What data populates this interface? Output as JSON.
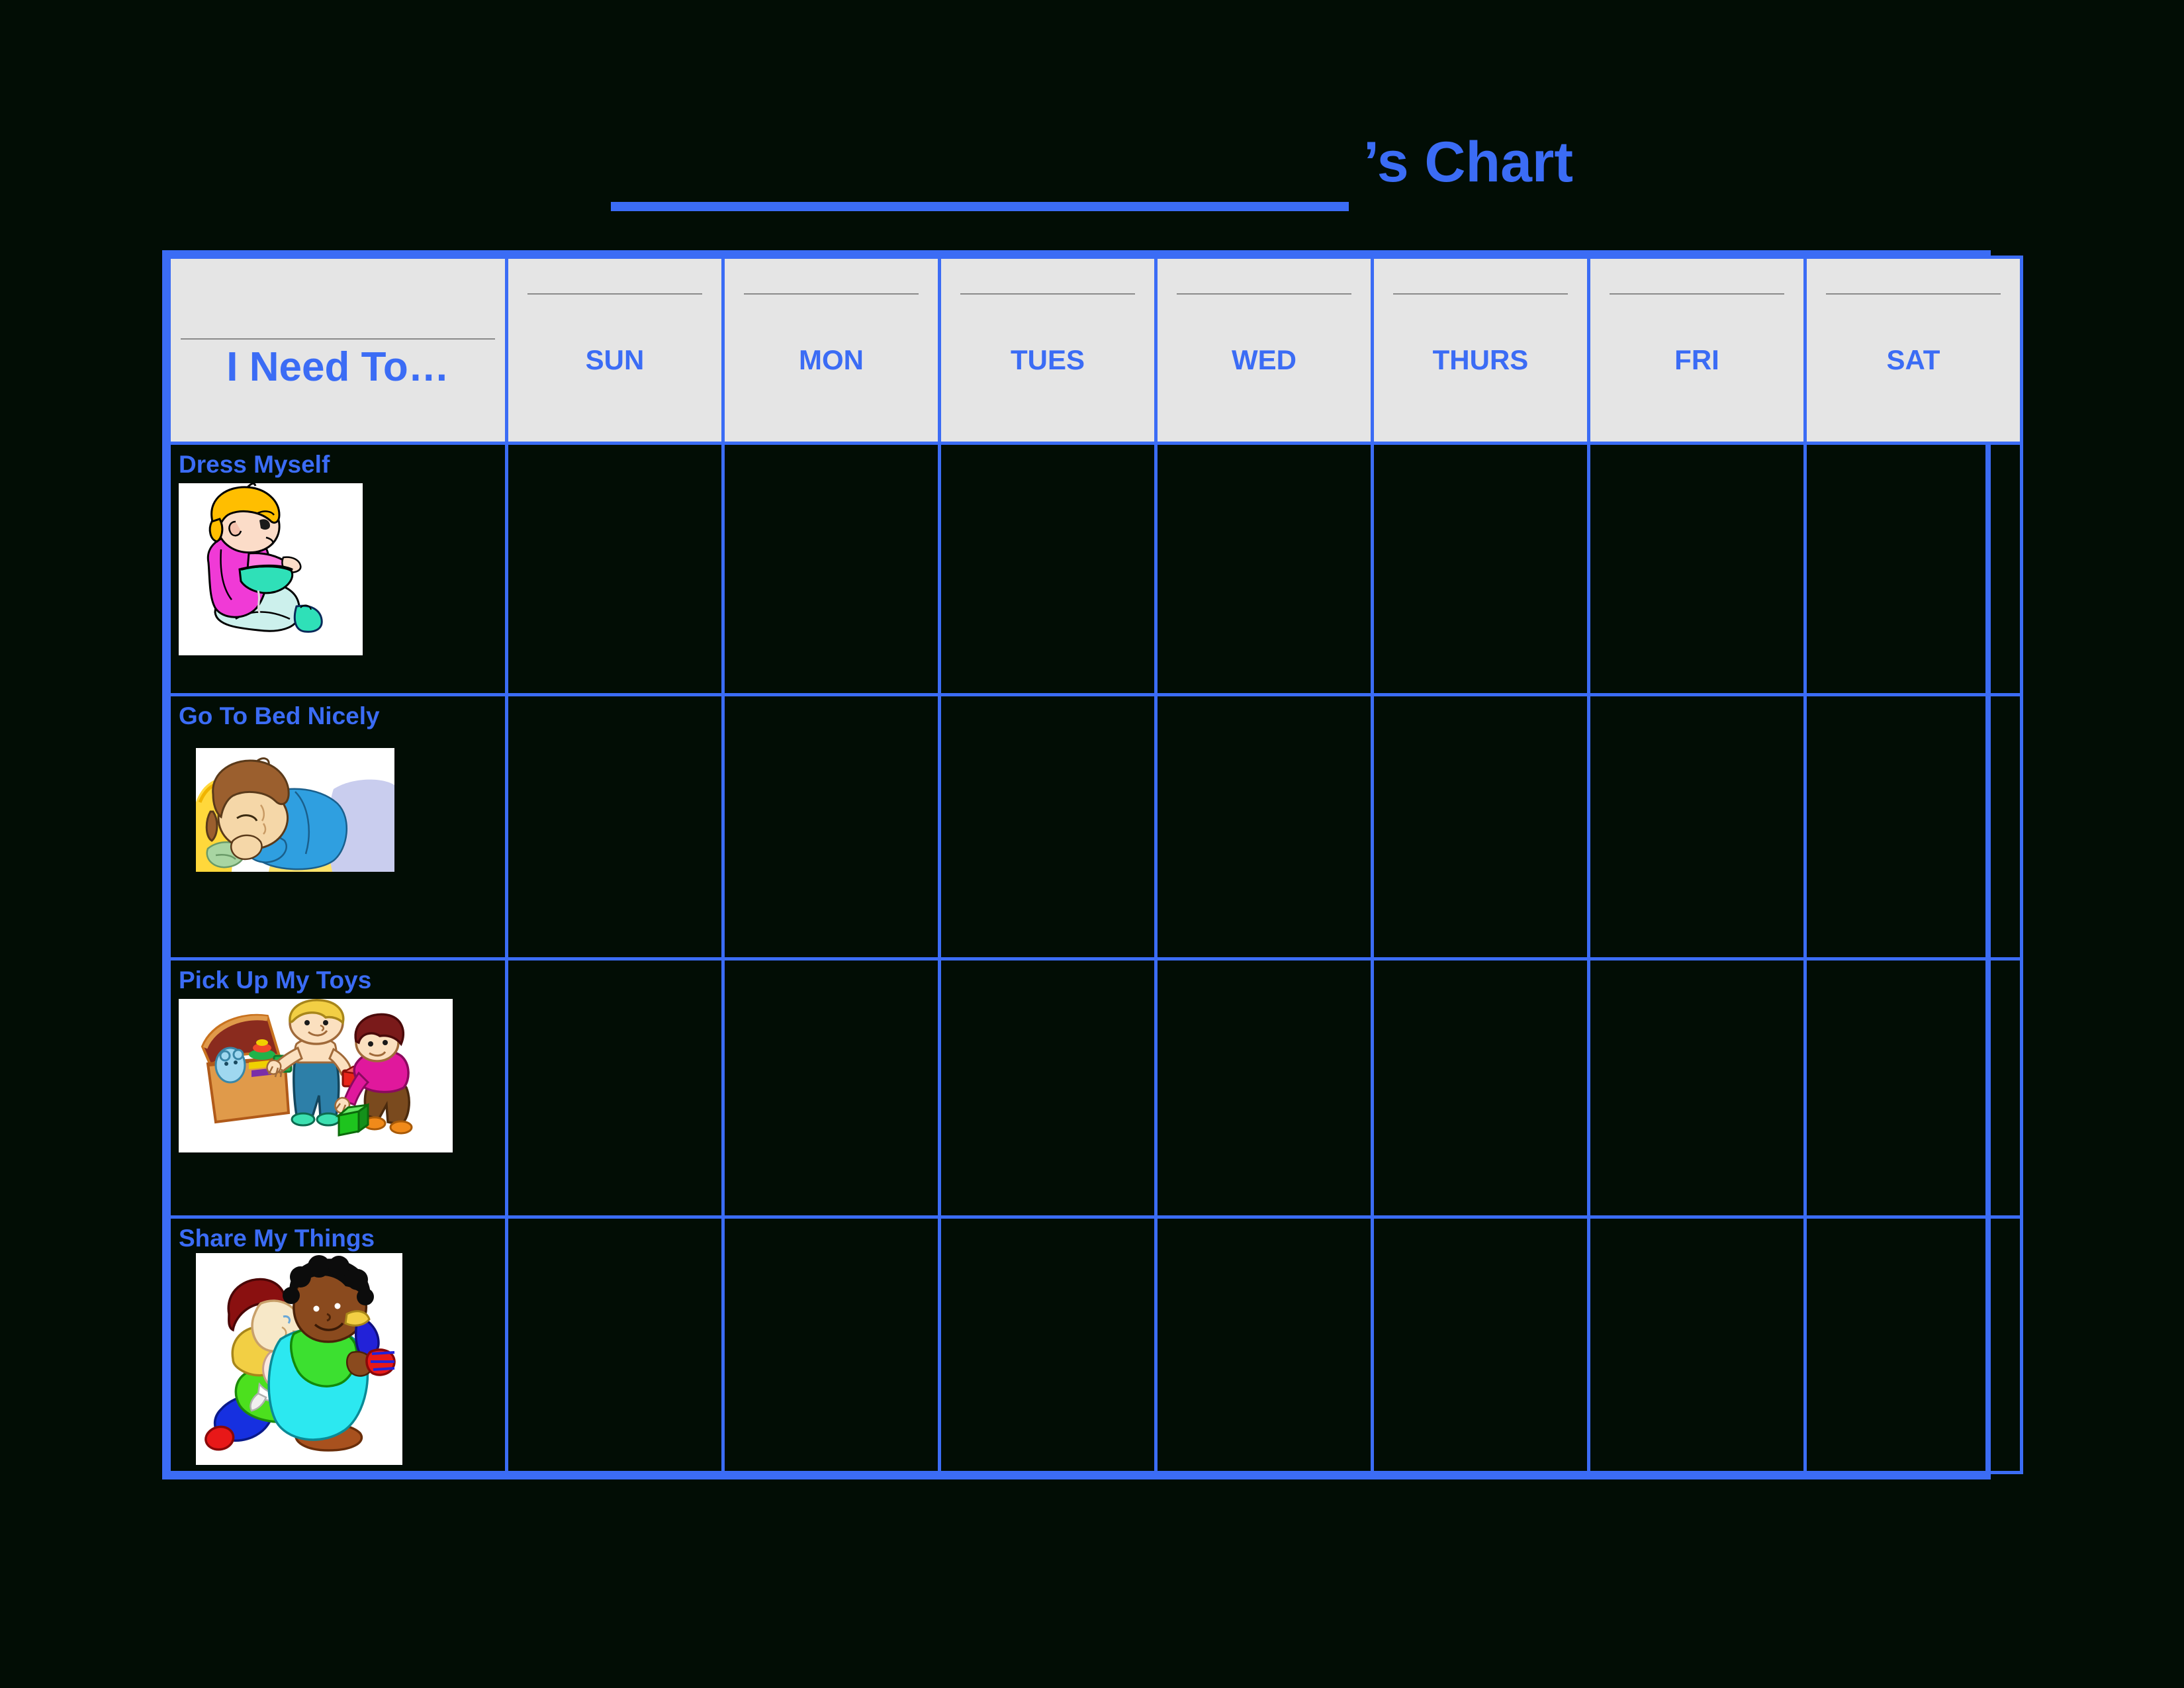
{
  "title": {
    "blank_label": "",
    "suffix": "’s Chart"
  },
  "colors": {
    "accent_blue": "#3b6cf5",
    "header_fill": "#e5e5e5",
    "header_rule": "#8a8a8a",
    "page_background": "#020d05",
    "art_background": "#ffffff"
  },
  "table": {
    "headers": [
      {
        "label": "I Need To…",
        "name": "task-column-header"
      },
      {
        "label": "SUN",
        "name": "day-column-header-sun"
      },
      {
        "label": "MON",
        "name": "day-column-header-mon"
      },
      {
        "label": "TUES",
        "name": "day-column-header-tues"
      },
      {
        "label": "WED",
        "name": "day-column-header-wed"
      },
      {
        "label": "THURS",
        "name": "day-column-header-thurs"
      },
      {
        "label": "FRI",
        "name": "day-column-header-fri"
      },
      {
        "label": "SAT",
        "name": "day-column-header-sat"
      }
    ],
    "rows": [
      {
        "task": "Dress Myself",
        "art": "child-putting-on-shoe-illustration",
        "cells": [
          "",
          "",
          "",
          "",
          "",
          "",
          ""
        ]
      },
      {
        "task": "Go To Bed Nicely",
        "art": "child-sleeping-in-bed-illustration",
        "cells": [
          "",
          "",
          "",
          "",
          "",
          "",
          ""
        ]
      },
      {
        "task": "Pick Up My Toys",
        "art": "children-with-toy-chest-illustration",
        "cells": [
          "",
          "",
          "",
          "",
          "",
          "",
          ""
        ]
      },
      {
        "task": "Share My Things",
        "art": "children-hugging-sharing-illustration",
        "cells": [
          "",
          "",
          "",
          "",
          "",
          "",
          ""
        ]
      }
    ]
  },
  "chart_data": {
    "type": "table",
    "title": "’s Chart",
    "categories": [
      "SUN",
      "MON",
      "TUES",
      "WED",
      "THURS",
      "FRI",
      "SAT"
    ],
    "row_label_header": "I Need To…",
    "rows": [
      {
        "name": "Dress Myself",
        "values": [
          "",
          "",
          "",
          "",
          "",
          "",
          ""
        ]
      },
      {
        "name": "Go To Bed Nicely",
        "values": [
          "",
          "",
          "",
          "",
          "",
          "",
          ""
        ]
      },
      {
        "name": "Pick Up My Toys",
        "values": [
          "",
          "",
          "",
          "",
          "",
          "",
          ""
        ]
      },
      {
        "name": "Share My Things",
        "values": [
          "",
          "",
          "",
          "",
          "",
          "",
          ""
        ]
      }
    ],
    "grid": true,
    "legend": "none",
    "note": "Blank weekly behavior sticker chart; all day cells are empty."
  }
}
